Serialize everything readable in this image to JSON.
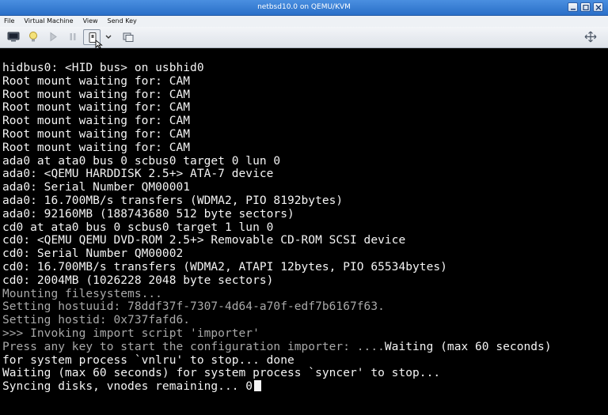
{
  "window": {
    "title": "netbsd10.0 on QEMU/KVM"
  },
  "menubar": {
    "items": [
      "File",
      "Virtual Machine",
      "View",
      "Send Key"
    ]
  },
  "toolbar": {
    "icons": [
      "console-icon",
      "lightbulb-icon",
      "play-icon",
      "pause-icon",
      "power-icon",
      "chevron-down-icon",
      "snapshot-icon",
      "fullscreen-icon"
    ]
  },
  "console": {
    "lines": [
      {
        "text": "hidbus0: <HID bus> on usbhid0",
        "tone": "w"
      },
      {
        "text": "Root mount waiting for: CAM",
        "tone": "w"
      },
      {
        "text": "Root mount waiting for: CAM",
        "tone": "w"
      },
      {
        "text": "Root mount waiting for: CAM",
        "tone": "w"
      },
      {
        "text": "Root mount waiting for: CAM",
        "tone": "w"
      },
      {
        "text": "Root mount waiting for: CAM",
        "tone": "w"
      },
      {
        "text": "Root mount waiting for: CAM",
        "tone": "w"
      },
      {
        "text": "ada0 at ata0 bus 0 scbus0 target 0 lun 0",
        "tone": "w"
      },
      {
        "text": "ada0: <QEMU HARDDISK 2.5+> ATA-7 device",
        "tone": "w"
      },
      {
        "text": "ada0: Serial Number QM00001",
        "tone": "w"
      },
      {
        "text": "ada0: 16.700MB/s transfers (WDMA2, PIO 8192bytes)",
        "tone": "w"
      },
      {
        "text": "ada0: 92160MB (188743680 512 byte sectors)",
        "tone": "w"
      },
      {
        "text": "cd0 at ata0 bus 0 scbus0 target 1 lun 0",
        "tone": "w"
      },
      {
        "text": "cd0: <QEMU QEMU DVD-ROM 2.5+> Removable CD-ROM SCSI device",
        "tone": "w"
      },
      {
        "text": "cd0: Serial Number QM00002",
        "tone": "w"
      },
      {
        "text": "cd0: 16.700MB/s transfers (WDMA2, ATAPI 12bytes, PIO 65534bytes)",
        "tone": "w"
      },
      {
        "text": "cd0: 2004MB (1026228 2048 byte sectors)",
        "tone": "w"
      },
      {
        "text": "Mounting filesystems...",
        "tone": "g"
      },
      {
        "text": "Setting hostuuid: 78ddf37f-7307-4d64-a70f-edf7b6167f63.",
        "tone": "g"
      },
      {
        "text": "Setting hostid: 0x737fafd6.",
        "tone": "g"
      },
      {
        "text": ">>> Invoking import script 'importer'",
        "tone": "g"
      },
      {
        "text": "Press any key to start the configuration importer: ....",
        "tone": "g",
        "tail": "Waiting (max 60 seconds)"
      },
      {
        "text": "for system process `vnlru' to stop... done",
        "tone": "w"
      },
      {
        "text": "Waiting (max 60 seconds) for system process `syncer' to stop...",
        "tone": "w"
      },
      {
        "text": "Syncing disks, vnodes remaining... 0",
        "tone": "w",
        "cursor": true
      }
    ]
  }
}
